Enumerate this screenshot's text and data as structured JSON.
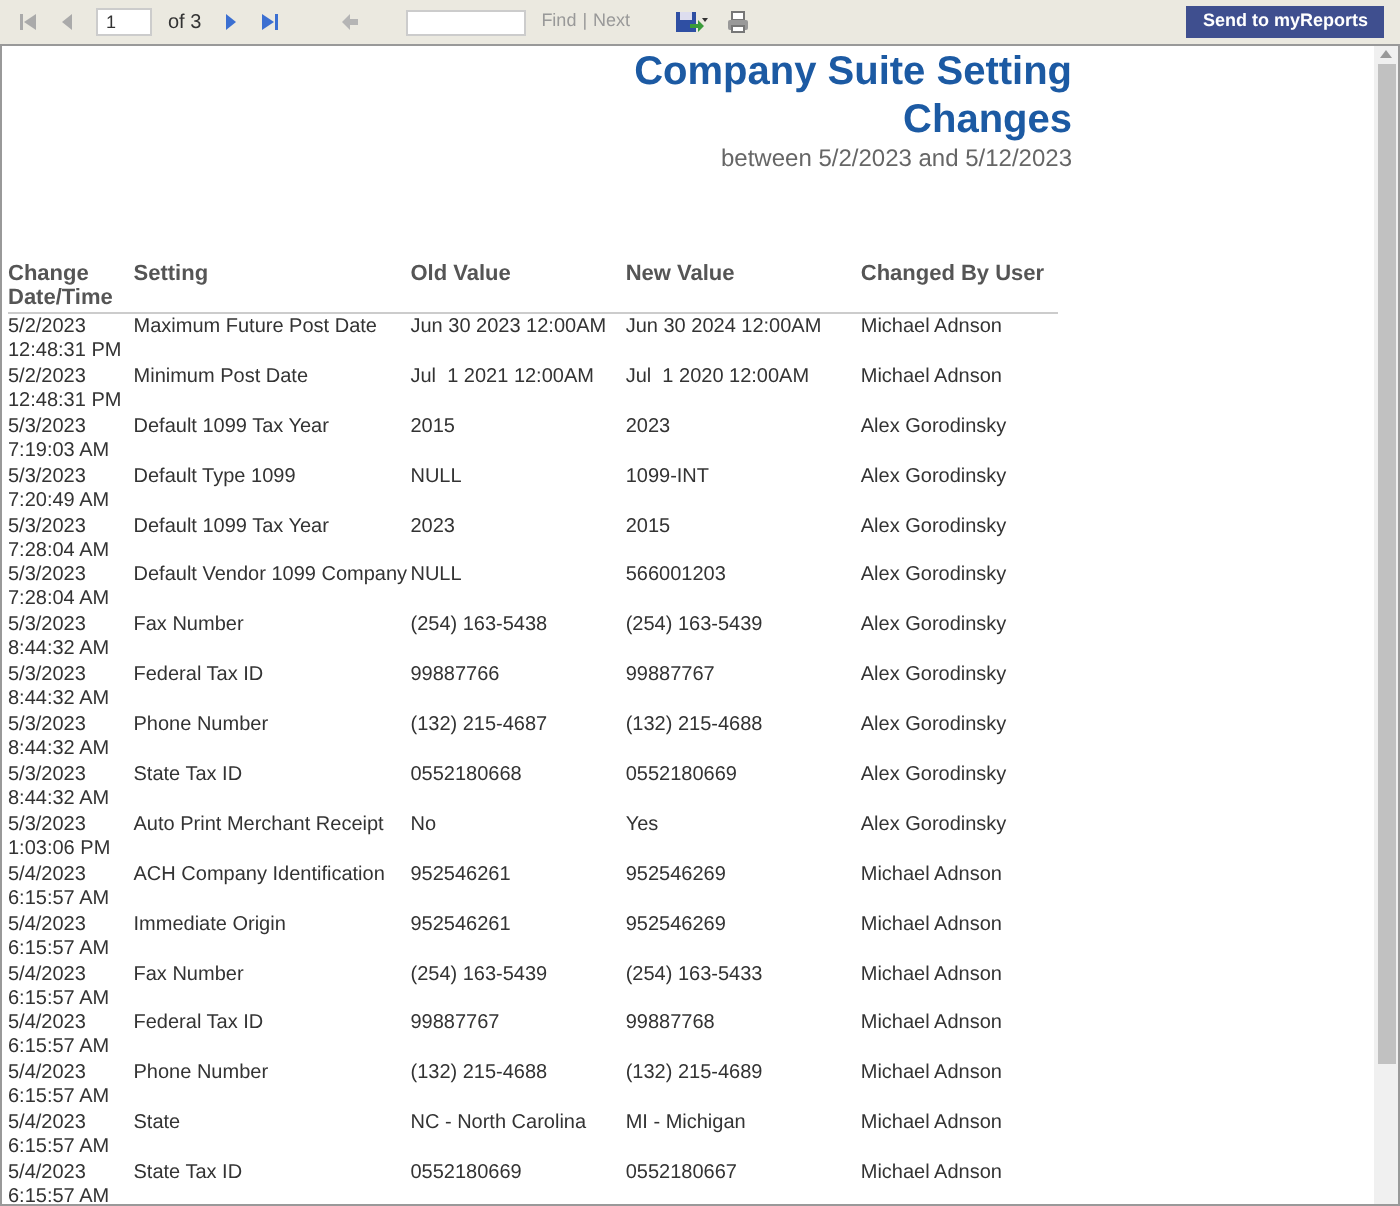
{
  "toolbar": {
    "page": "1",
    "page_count": "of 3",
    "find_label": "Find",
    "separator": "|",
    "next_label": "Next",
    "send_button": "Send to myReports"
  },
  "report": {
    "title_lines": [
      "Company Suite Setting",
      "Changes"
    ],
    "subtitle": "between 5/2/2023 and 5/12/2023",
    "columns": [
      [
        "Change",
        "Date/Time"
      ],
      [
        "Setting"
      ],
      [
        "Old Value"
      ],
      [
        "New Value"
      ],
      [
        "Changed By User"
      ]
    ],
    "rows": [
      {
        "date": "5/2/2023",
        "time": "12:48:31 PM",
        "setting": "Maximum Future Post Date",
        "old": "Jun 30 2023 12:00AM",
        "new": "Jun 30 2024 12:00AM",
        "user": "Michael Adnson"
      },
      {
        "date": "5/2/2023",
        "time": "12:48:31 PM",
        "setting": "Minimum Post Date",
        "old": "Jul  1 2021 12:00AM",
        "new": "Jul  1 2020 12:00AM",
        "user": "Michael Adnson"
      },
      {
        "date": "5/3/2023",
        "time": "7:19:03 AM",
        "setting": "Default 1099 Tax Year",
        "old": "2015",
        "new": "2023",
        "user": "Alex Gorodinsky"
      },
      {
        "date": "5/3/2023",
        "time": "7:20:49 AM",
        "setting": "Default Type 1099",
        "old": "NULL",
        "new": "1099-INT",
        "user": "Alex Gorodinsky"
      },
      {
        "date": "5/3/2023",
        "time": "7:28:04 AM",
        "setting": "Default 1099 Tax Year",
        "old": "2023",
        "new": "2015",
        "user": "Alex Gorodinsky"
      },
      {
        "date": "5/3/2023",
        "time": "7:28:04 AM",
        "setting": "Default Vendor 1099 Company",
        "old": "NULL",
        "new": "566001203",
        "user": "Alex Gorodinsky"
      },
      {
        "date": "5/3/2023",
        "time": "8:44:32 AM",
        "setting": "Fax Number",
        "old": "(254) 163-5438",
        "new": "(254) 163-5439",
        "user": "Alex Gorodinsky"
      },
      {
        "date": "5/3/2023",
        "time": "8:44:32 AM",
        "setting": "Federal Tax ID",
        "old": "99887766",
        "new": "99887767",
        "user": "Alex Gorodinsky"
      },
      {
        "date": "5/3/2023",
        "time": "8:44:32 AM",
        "setting": "Phone Number",
        "old": "(132) 215-4687",
        "new": "(132) 215-4688",
        "user": "Alex Gorodinsky"
      },
      {
        "date": "5/3/2023",
        "time": "8:44:32 AM",
        "setting": "State Tax ID",
        "old": "0552180668",
        "new": "0552180669",
        "user": "Alex Gorodinsky"
      },
      {
        "date": "5/3/2023",
        "time": "1:03:06 PM",
        "setting": "Auto Print Merchant Receipt",
        "old": "No",
        "new": "Yes",
        "user": "Alex Gorodinsky"
      },
      {
        "date": "5/4/2023",
        "time": "6:15:57 AM",
        "setting": "ACH Company Identification",
        "old": "952546261",
        "new": "952546269",
        "user": "Michael Adnson"
      },
      {
        "date": "5/4/2023",
        "time": "6:15:57 AM",
        "setting": "Immediate Origin",
        "old": "952546261",
        "new": "952546269",
        "user": "Michael Adnson"
      },
      {
        "date": "5/4/2023",
        "time": "6:15:57 AM",
        "setting": "Fax Number",
        "old": "(254) 163-5439",
        "new": "(254) 163-5433",
        "user": "Michael Adnson"
      },
      {
        "date": "5/4/2023",
        "time": "6:15:57 AM",
        "setting": "Federal Tax ID",
        "old": "99887767",
        "new": "99887768",
        "user": "Michael Adnson"
      },
      {
        "date": "5/4/2023",
        "time": "6:15:57 AM",
        "setting": "Phone Number",
        "old": "(132) 215-4688",
        "new": "(132) 215-4689",
        "user": "Michael Adnson"
      },
      {
        "date": "5/4/2023",
        "time": "6:15:57 AM",
        "setting": "State",
        "old": "NC - North Carolina",
        "new": "MI - Michigan",
        "user": "Michael Adnson"
      },
      {
        "date": "5/4/2023",
        "time": "6:15:57 AM",
        "setting": "State Tax ID",
        "old": "0552180669",
        "new": "0552180667",
        "user": "Michael Adnson"
      }
    ]
  }
}
